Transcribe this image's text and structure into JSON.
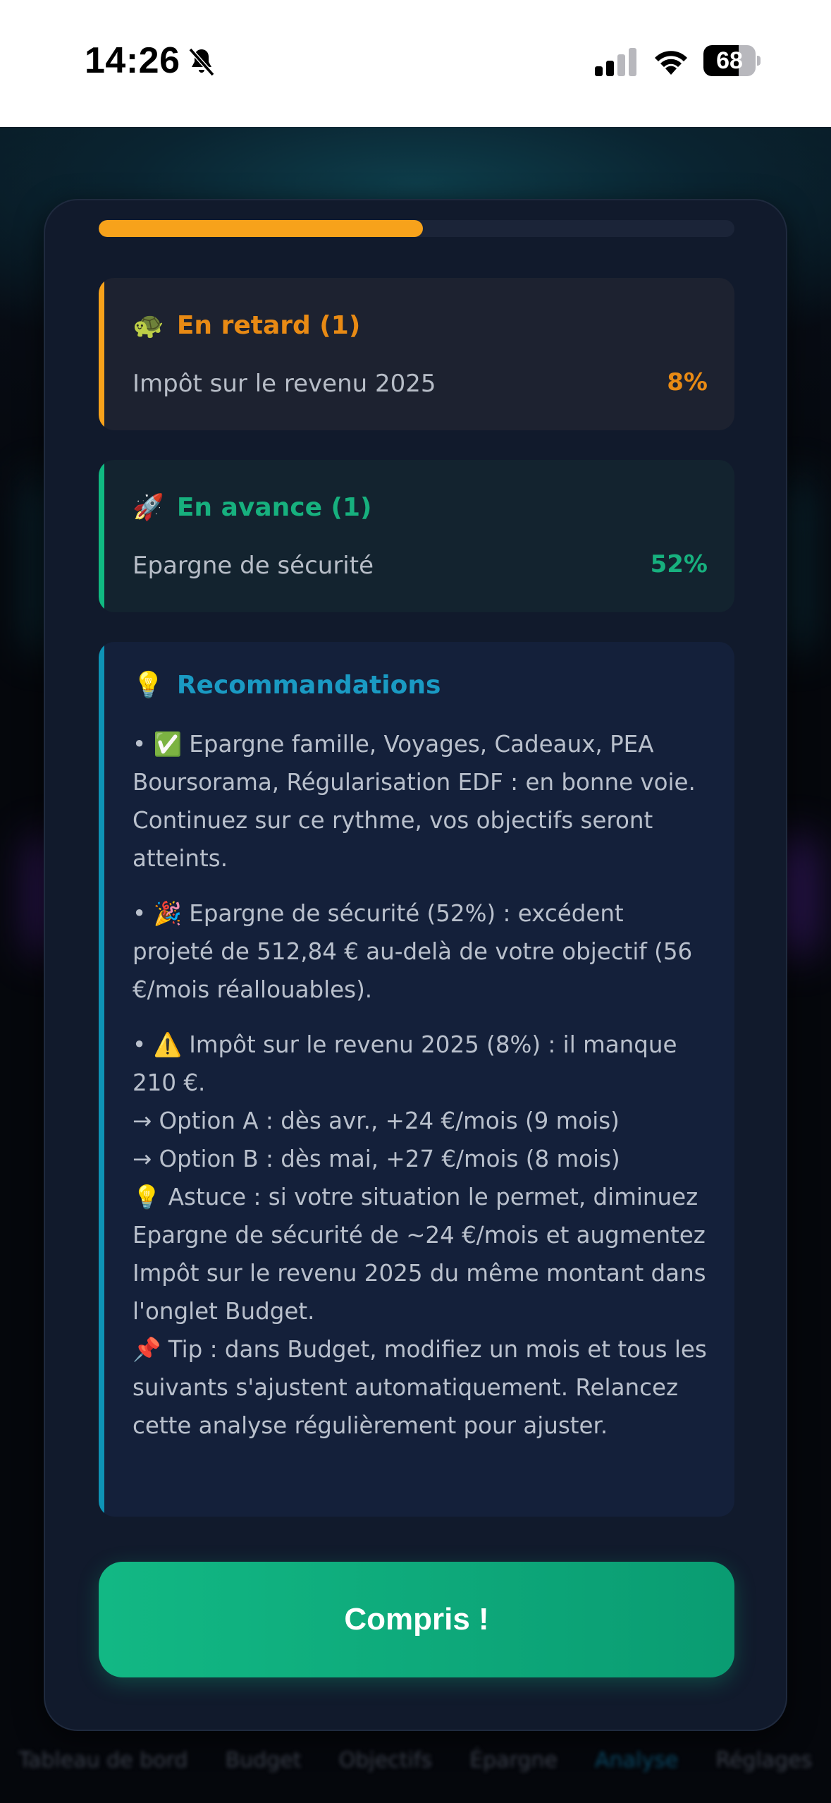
{
  "status_bar": {
    "time": "14:26",
    "battery_level": "68",
    "battery_fraction": 0.68
  },
  "background_tabs": [
    "Tableau de bord",
    "Budget",
    "Objectifs",
    "Épargne",
    "Analyse",
    "Réglages"
  ],
  "modal": {
    "progress_fraction": 0.51,
    "late": {
      "emoji": "🐢",
      "title": "En retard (1)",
      "item_label": "Impôt sur le revenu 2025",
      "item_value": "8%",
      "accent": "#f7a21b"
    },
    "ahead": {
      "emoji": "🚀",
      "title": "En avance (1)",
      "item_label": "Epargne de sécurité",
      "item_value": "52%",
      "accent": "#10b981"
    },
    "recommendations": {
      "emoji": "💡",
      "title": "Recommandations",
      "accent": "#0e93b5",
      "p1": "• ✅ Epargne famille, Voyages, Cadeaux, PEA Boursorama, Régularisation EDF : en bonne voie. Continuez sur ce rythme, vos objectifs seront atteints.",
      "p2": "• 🎉 Epargne de sécurité (52%) : excédent projeté de 512,84 € au-delà de votre objectif (56 €/mois réallouables).",
      "p3_l1": "• ⚠️ Impôt sur le revenu 2025 (8%) : il manque 210 €.",
      "p3_l2": "→ Option A : dès avr., +24 €/mois (9 mois)",
      "p3_l3": "→ Option B : dès mai, +27 €/mois (8 mois)",
      "p3_l4": "💡  Astuce : si votre situation le permet, diminuez Epargne de sécurité de ~24 €/mois et augmentez Impôt sur le revenu 2025 du même montant dans l'onglet Budget.",
      "p3_l5": "📌 Tip : dans Budget, modifiez un mois et tous les suivants s'ajustent automatiquement. Relancez cette analyse régulièrement pour ajuster."
    },
    "cta_label": "Compris !",
    "cta_color": "#10b981"
  }
}
